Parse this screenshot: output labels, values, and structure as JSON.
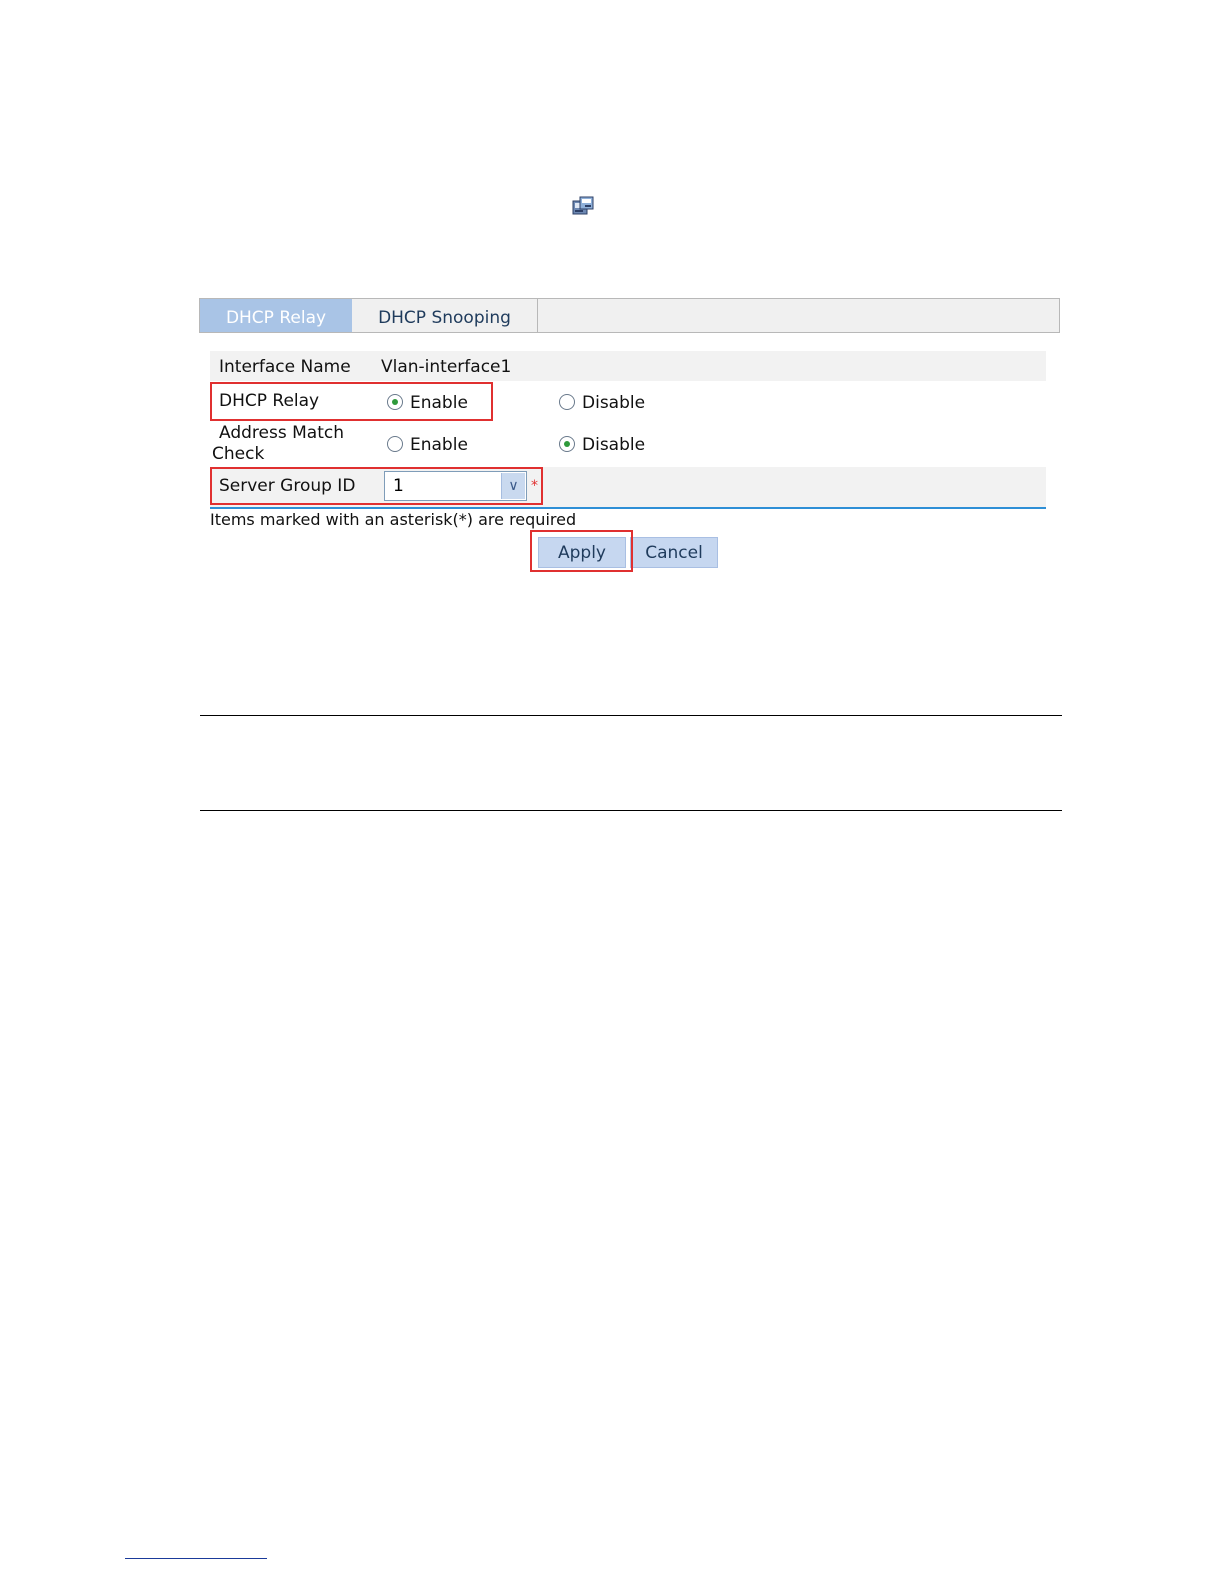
{
  "icons": {
    "config": "config-icon"
  },
  "tabs": {
    "active": "DHCP Relay",
    "inactive": "DHCP Snooping"
  },
  "form": {
    "interface_name_label": "Interface Name",
    "interface_name_value": "Vlan-interface1",
    "dhcp_relay_label": "DHCP Relay",
    "dhcp_relay_enable": "Enable",
    "dhcp_relay_disable": "Disable",
    "dhcp_relay_selected": "Enable",
    "address_match_label_line1": "Address Match",
    "address_match_label_line2": "Check",
    "address_match_enable": "Enable",
    "address_match_disable": "Disable",
    "address_match_selected": "Disable",
    "server_group_label": "Server Group ID",
    "server_group_value": "1",
    "required_marker": "*",
    "required_note": "Items marked with an asterisk(*) are required"
  },
  "buttons": {
    "apply": "Apply",
    "cancel": "Cancel"
  },
  "colors": {
    "tab_active_bg": "#a9c4e6",
    "highlight_box": "#e03030",
    "button_bg": "#c6d7f0",
    "radio_selected": "#2f9a3b"
  }
}
